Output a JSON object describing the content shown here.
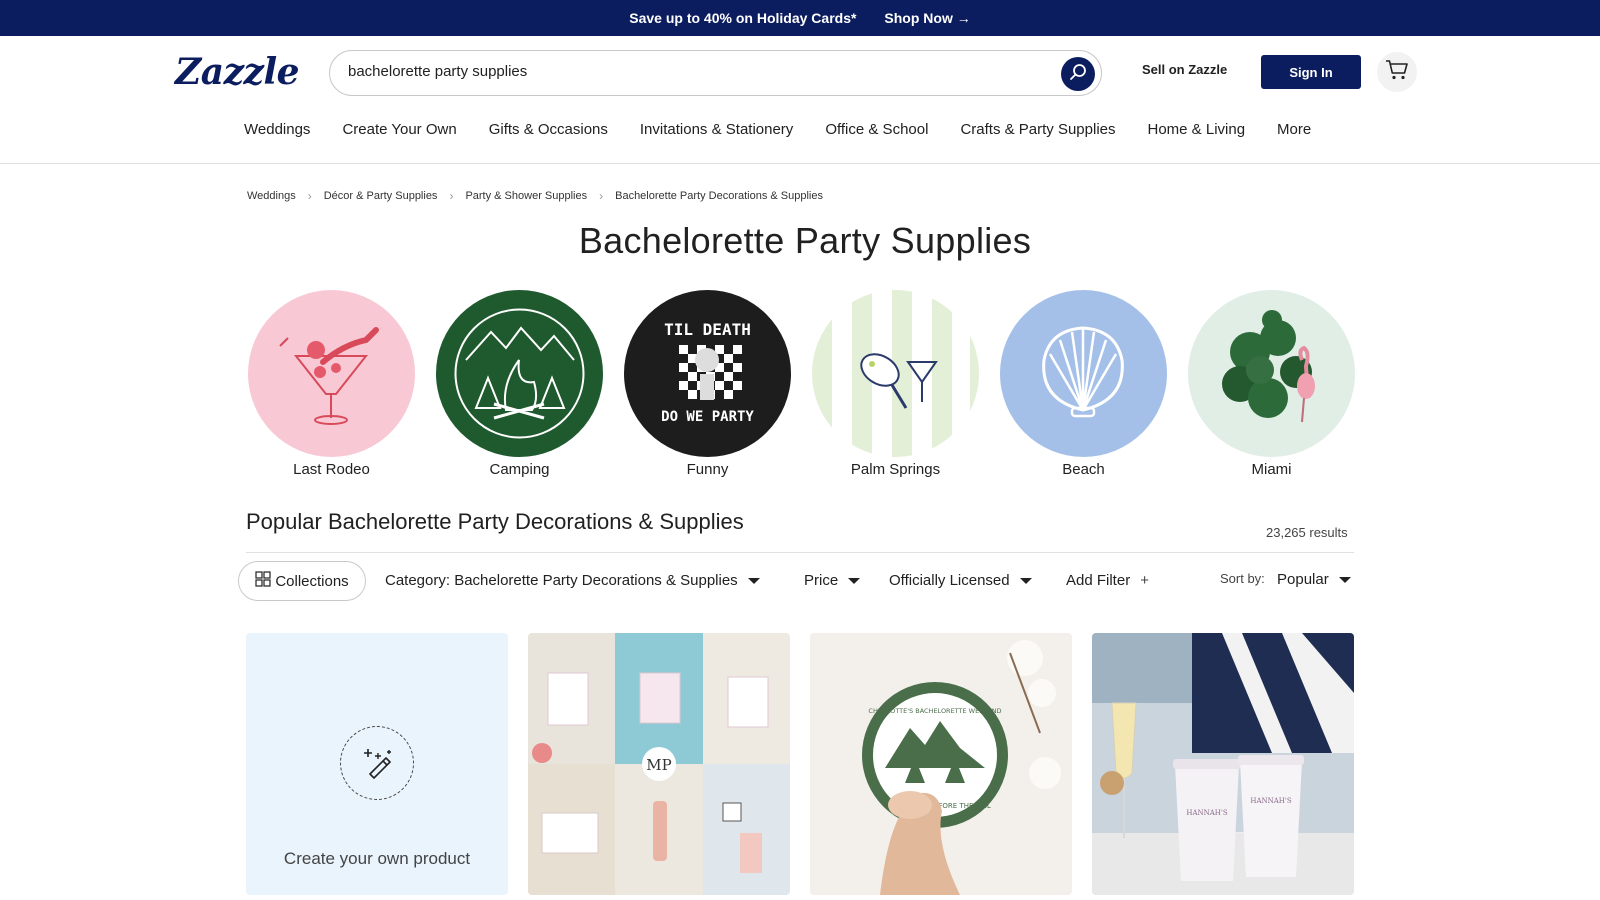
{
  "promo": {
    "text": "Save up to 40% on Holiday Cards*",
    "cta": "Shop Now →"
  },
  "header": {
    "logo": "Zazzle",
    "search_value": "bachelorette party supplies",
    "sell_label": "Sell on Zazzle",
    "signin_label": "Sign In"
  },
  "nav": [
    "Weddings",
    "Create Your Own",
    "Gifts & Occasions",
    "Invitations & Stationery",
    "Office & School",
    "Crafts & Party Supplies",
    "Home & Living",
    "More"
  ],
  "breadcrumb": [
    "Weddings",
    "Décor & Party Supplies",
    "Party & Shower Supplies",
    "Bachelorette Party Decorations & Supplies"
  ],
  "page_title": "Bachelorette Party Supplies",
  "themes": [
    {
      "label": "Last Rodeo",
      "color": "#f8c9d4"
    },
    {
      "label": "Camping",
      "color": "#1f5a2f"
    },
    {
      "label": "Funny",
      "color": "#1d1d1d"
    },
    {
      "label": "Palm Springs",
      "color": "#e3efd6"
    },
    {
      "label": "Beach",
      "color": "#a5c0e8"
    },
    {
      "label": "Miami",
      "color": "#e0eee6"
    }
  ],
  "theme_funny_text": {
    "top": "TIL DEATH",
    "bottom": "DO WE PARTY"
  },
  "section_title": "Popular Bachelorette Party Decorations & Supplies",
  "results": "23,265 results",
  "filters": {
    "collections": "Collections",
    "category": "Category: Bachelorette Party Decorations & Supplies",
    "price": "Price",
    "licensed": "Officially Licensed",
    "add_filter": "Add Filter",
    "add_filter_icon": "+",
    "sort_label": "Sort by:",
    "sort_value": "Popular"
  },
  "products": {
    "create_label": "Create your own product",
    "monogram": "MP",
    "sticker_text": "CHARLOTTE'S BACHELORETTE WEEKEND",
    "sticker_sub": "BEFORE THE VEIL",
    "cup_text": "HANNAH'S"
  },
  "colors": {
    "brand": "#0b1d5e",
    "create_bg": "#eaf4fc"
  }
}
